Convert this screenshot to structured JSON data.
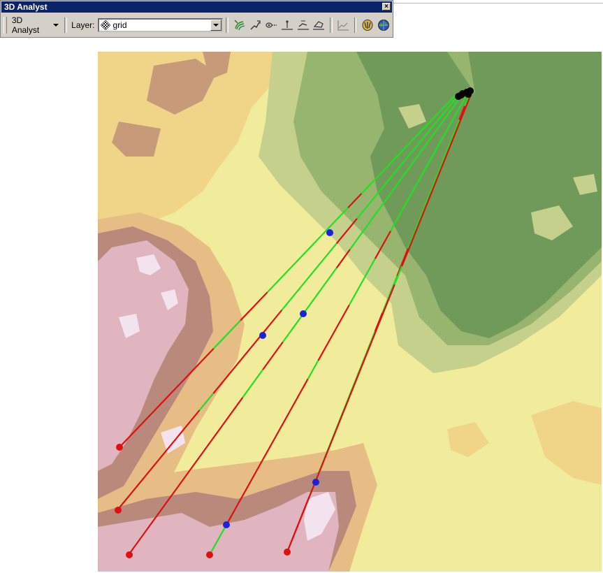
{
  "window": {
    "title": "3D Analyst",
    "close_label": "×"
  },
  "toolbar": {
    "menu_label": "3D Analyst",
    "layer_label": "Layer:",
    "layer_value": "grid",
    "tools": [
      "contour-tool-icon",
      "steepest-path-tool-icon",
      "line-of-sight-tool-icon",
      "interpolate-point-tool-icon",
      "interpolate-line-tool-icon",
      "interpolate-polygon-tool-icon",
      "profile-graph-tool-icon",
      "arcscene-launch-icon",
      "arcglobe-launch-icon"
    ]
  },
  "map": {
    "observer_color": "#000000",
    "visible_color": "#22e022",
    "hidden_color": "#dd1111",
    "obstruction_color": "#1a22dd",
    "target_color": "#e01010",
    "elevation_palette": [
      "#6f9a5a",
      "#98b570",
      "#c4d08c",
      "#f1ec9c",
      "#f0d488",
      "#e6bd84",
      "#c79a7a",
      "#b98a7c",
      "#e0b5bf",
      "#f3e3ee"
    ]
  }
}
